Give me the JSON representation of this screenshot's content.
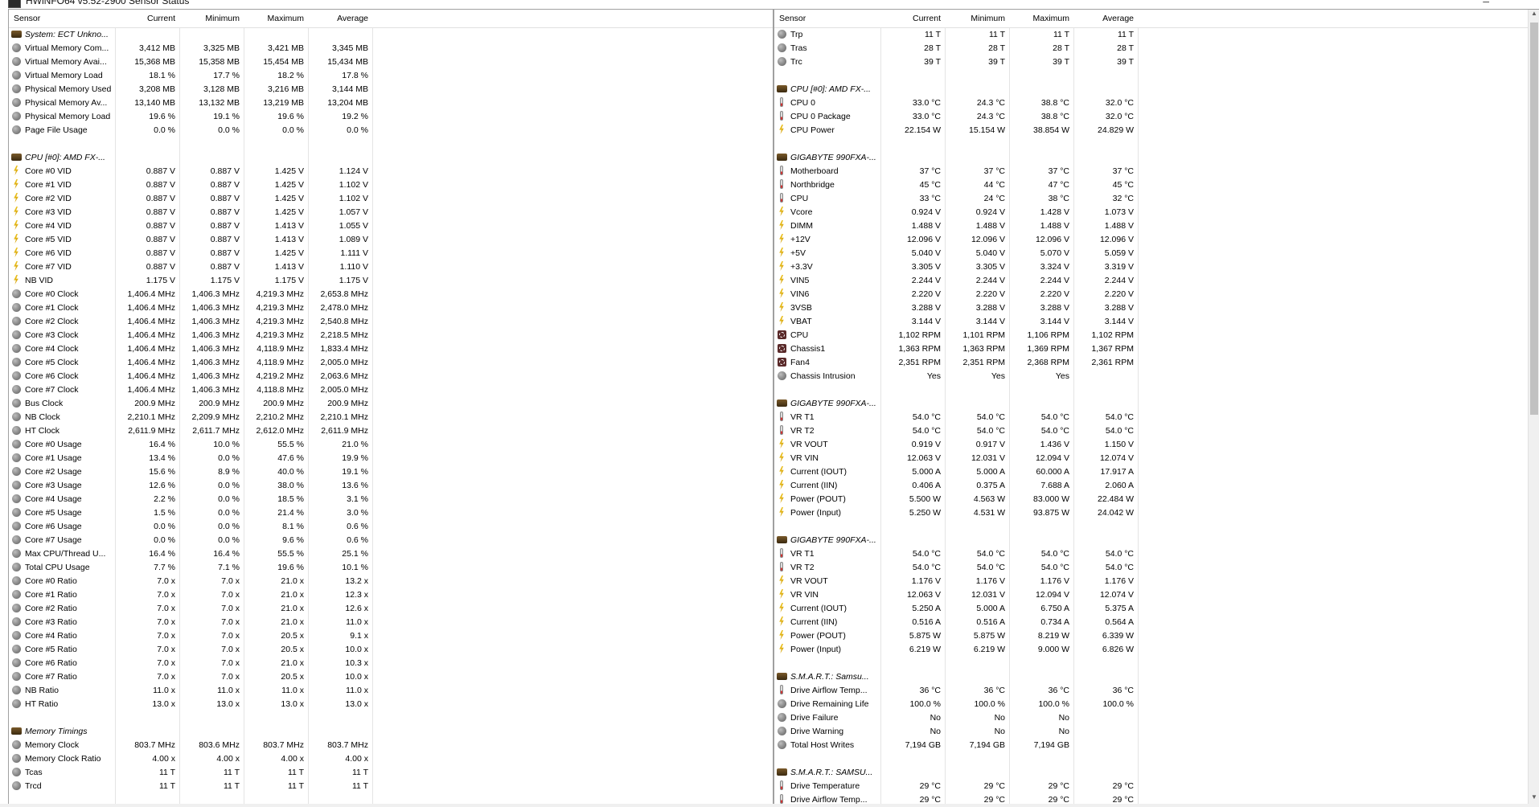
{
  "window": {
    "title": "HWiNFO64 v5.52-2900 Sensor Status"
  },
  "columns": {
    "sensor": "Sensor",
    "current": "Current",
    "minimum": "Minimum",
    "maximum": "Maximum",
    "average": "Average"
  },
  "left_rows": [
    {
      "type": "group",
      "icon": "chip",
      "label": "System: ECT Unkno..."
    },
    {
      "icon": "circle",
      "label": "Virtual Memory Com...",
      "cur": "3,412 MB",
      "min": "3,325 MB",
      "max": "3,421 MB",
      "avg": "3,345 MB"
    },
    {
      "icon": "circle",
      "label": "Virtual Memory Avai...",
      "cur": "15,368 MB",
      "min": "15,358 MB",
      "max": "15,454 MB",
      "avg": "15,434 MB"
    },
    {
      "icon": "circle",
      "label": "Virtual Memory Load",
      "cur": "18.1 %",
      "min": "17.7 %",
      "max": "18.2 %",
      "avg": "17.8 %"
    },
    {
      "icon": "circle",
      "label": "Physical Memory Used",
      "cur": "3,208 MB",
      "min": "3,128 MB",
      "max": "3,216 MB",
      "avg": "3,144 MB"
    },
    {
      "icon": "circle",
      "label": "Physical Memory Av...",
      "cur": "13,140 MB",
      "min": "13,132 MB",
      "max": "13,219 MB",
      "avg": "13,204 MB"
    },
    {
      "icon": "circle",
      "label": "Physical Memory Load",
      "cur": "19.6 %",
      "min": "19.1 %",
      "max": "19.6 %",
      "avg": "19.2 %"
    },
    {
      "icon": "circle",
      "label": "Page File Usage",
      "cur": "0.0 %",
      "min": "0.0 %",
      "max": "0.0 %",
      "avg": "0.0 %"
    },
    {
      "type": "blank"
    },
    {
      "type": "group",
      "icon": "chip",
      "label": "CPU [#0]: AMD FX-..."
    },
    {
      "icon": "bolt",
      "label": "Core #0 VID",
      "cur": "0.887 V",
      "min": "0.887 V",
      "max": "1.425 V",
      "avg": "1.124 V"
    },
    {
      "icon": "bolt",
      "label": "Core #1 VID",
      "cur": "0.887 V",
      "min": "0.887 V",
      "max": "1.425 V",
      "avg": "1.102 V"
    },
    {
      "icon": "bolt",
      "label": "Core #2 VID",
      "cur": "0.887 V",
      "min": "0.887 V",
      "max": "1.425 V",
      "avg": "1.102 V"
    },
    {
      "icon": "bolt",
      "label": "Core #3 VID",
      "cur": "0.887 V",
      "min": "0.887 V",
      "max": "1.425 V",
      "avg": "1.057 V"
    },
    {
      "icon": "bolt",
      "label": "Core #4 VID",
      "cur": "0.887 V",
      "min": "0.887 V",
      "max": "1.413 V",
      "avg": "1.055 V"
    },
    {
      "icon": "bolt",
      "label": "Core #5 VID",
      "cur": "0.887 V",
      "min": "0.887 V",
      "max": "1.413 V",
      "avg": "1.089 V"
    },
    {
      "icon": "bolt",
      "label": "Core #6 VID",
      "cur": "0.887 V",
      "min": "0.887 V",
      "max": "1.425 V",
      "avg": "1.111 V"
    },
    {
      "icon": "bolt",
      "label": "Core #7 VID",
      "cur": "0.887 V",
      "min": "0.887 V",
      "max": "1.413 V",
      "avg": "1.110 V"
    },
    {
      "icon": "bolt",
      "label": "NB VID",
      "cur": "1.175 V",
      "min": "1.175 V",
      "max": "1.175 V",
      "avg": "1.175 V"
    },
    {
      "icon": "circle",
      "label": "Core #0 Clock",
      "cur": "1,406.4 MHz",
      "min": "1,406.3 MHz",
      "max": "4,219.3 MHz",
      "avg": "2,653.8 MHz"
    },
    {
      "icon": "circle",
      "label": "Core #1 Clock",
      "cur": "1,406.4 MHz",
      "min": "1,406.3 MHz",
      "max": "4,219.3 MHz",
      "avg": "2,478.0 MHz"
    },
    {
      "icon": "circle",
      "label": "Core #2 Clock",
      "cur": "1,406.4 MHz",
      "min": "1,406.3 MHz",
      "max": "4,219.3 MHz",
      "avg": "2,540.8 MHz"
    },
    {
      "icon": "circle",
      "label": "Core #3 Clock",
      "cur": "1,406.4 MHz",
      "min": "1,406.3 MHz",
      "max": "4,219.3 MHz",
      "avg": "2,218.5 MHz"
    },
    {
      "icon": "circle",
      "label": "Core #4 Clock",
      "cur": "1,406.4 MHz",
      "min": "1,406.3 MHz",
      "max": "4,118.9 MHz",
      "avg": "1,833.4 MHz"
    },
    {
      "icon": "circle",
      "label": "Core #5 Clock",
      "cur": "1,406.4 MHz",
      "min": "1,406.3 MHz",
      "max": "4,118.9 MHz",
      "avg": "2,005.0 MHz"
    },
    {
      "icon": "circle",
      "label": "Core #6 Clock",
      "cur": "1,406.4 MHz",
      "min": "1,406.3 MHz",
      "max": "4,219.2 MHz",
      "avg": "2,063.6 MHz"
    },
    {
      "icon": "circle",
      "label": "Core #7 Clock",
      "cur": "1,406.4 MHz",
      "min": "1,406.3 MHz",
      "max": "4,118.8 MHz",
      "avg": "2,005.0 MHz"
    },
    {
      "icon": "circle",
      "label": "Bus Clock",
      "cur": "200.9 MHz",
      "min": "200.9 MHz",
      "max": "200.9 MHz",
      "avg": "200.9 MHz"
    },
    {
      "icon": "circle",
      "label": "NB Clock",
      "cur": "2,210.1 MHz",
      "min": "2,209.9 MHz",
      "max": "2,210.2 MHz",
      "avg": "2,210.1 MHz"
    },
    {
      "icon": "circle",
      "label": "HT Clock",
      "cur": "2,611.9 MHz",
      "min": "2,611.7 MHz",
      "max": "2,612.0 MHz",
      "avg": "2,611.9 MHz"
    },
    {
      "icon": "circle",
      "label": "Core #0 Usage",
      "cur": "16.4 %",
      "min": "10.0 %",
      "max": "55.5 %",
      "avg": "21.0 %"
    },
    {
      "icon": "circle",
      "label": "Core #1 Usage",
      "cur": "13.4 %",
      "min": "0.0 %",
      "max": "47.6 %",
      "avg": "19.9 %"
    },
    {
      "icon": "circle",
      "label": "Core #2 Usage",
      "cur": "15.6 %",
      "min": "8.9 %",
      "max": "40.0 %",
      "avg": "19.1 %"
    },
    {
      "icon": "circle",
      "label": "Core #3 Usage",
      "cur": "12.6 %",
      "min": "0.0 %",
      "max": "38.0 %",
      "avg": "13.6 %"
    },
    {
      "icon": "circle",
      "label": "Core #4 Usage",
      "cur": "2.2 %",
      "min": "0.0 %",
      "max": "18.5 %",
      "avg": "3.1 %"
    },
    {
      "icon": "circle",
      "label": "Core #5 Usage",
      "cur": "1.5 %",
      "min": "0.0 %",
      "max": "21.4 %",
      "avg": "3.0 %"
    },
    {
      "icon": "circle",
      "label": "Core #6 Usage",
      "cur": "0.0 %",
      "min": "0.0 %",
      "max": "8.1 %",
      "avg": "0.6 %"
    },
    {
      "icon": "circle",
      "label": "Core #7 Usage",
      "cur": "0.0 %",
      "min": "0.0 %",
      "max": "9.6 %",
      "avg": "0.6 %"
    },
    {
      "icon": "circle",
      "label": "Max CPU/Thread U...",
      "cur": "16.4 %",
      "min": "16.4 %",
      "max": "55.5 %",
      "avg": "25.1 %"
    },
    {
      "icon": "circle",
      "label": "Total CPU Usage",
      "cur": "7.7 %",
      "min": "7.1 %",
      "max": "19.6 %",
      "avg": "10.1 %"
    },
    {
      "icon": "circle",
      "label": "Core #0 Ratio",
      "cur": "7.0 x",
      "min": "7.0 x",
      "max": "21.0 x",
      "avg": "13.2 x"
    },
    {
      "icon": "circle",
      "label": "Core #1 Ratio",
      "cur": "7.0 x",
      "min": "7.0 x",
      "max": "21.0 x",
      "avg": "12.3 x"
    },
    {
      "icon": "circle",
      "label": "Core #2 Ratio",
      "cur": "7.0 x",
      "min": "7.0 x",
      "max": "21.0 x",
      "avg": "12.6 x"
    },
    {
      "icon": "circle",
      "label": "Core #3 Ratio",
      "cur": "7.0 x",
      "min": "7.0 x",
      "max": "21.0 x",
      "avg": "11.0 x"
    },
    {
      "icon": "circle",
      "label": "Core #4 Ratio",
      "cur": "7.0 x",
      "min": "7.0 x",
      "max": "20.5 x",
      "avg": "9.1 x"
    },
    {
      "icon": "circle",
      "label": "Core #5 Ratio",
      "cur": "7.0 x",
      "min": "7.0 x",
      "max": "20.5 x",
      "avg": "10.0 x"
    },
    {
      "icon": "circle",
      "label": "Core #6 Ratio",
      "cur": "7.0 x",
      "min": "7.0 x",
      "max": "21.0 x",
      "avg": "10.3 x"
    },
    {
      "icon": "circle",
      "label": "Core #7 Ratio",
      "cur": "7.0 x",
      "min": "7.0 x",
      "max": "20.5 x",
      "avg": "10.0 x"
    },
    {
      "icon": "circle",
      "label": "NB Ratio",
      "cur": "11.0 x",
      "min": "11.0 x",
      "max": "11.0 x",
      "avg": "11.0 x"
    },
    {
      "icon": "circle",
      "label": "HT Ratio",
      "cur": "13.0 x",
      "min": "13.0 x",
      "max": "13.0 x",
      "avg": "13.0 x"
    },
    {
      "type": "blank"
    },
    {
      "type": "group",
      "icon": "chip",
      "label": "Memory Timings"
    },
    {
      "icon": "circle",
      "label": "Memory Clock",
      "cur": "803.7 MHz",
      "min": "803.6 MHz",
      "max": "803.7 MHz",
      "avg": "803.7 MHz"
    },
    {
      "icon": "circle",
      "label": "Memory Clock Ratio",
      "cur": "4.00 x",
      "min": "4.00 x",
      "max": "4.00 x",
      "avg": "4.00 x"
    },
    {
      "icon": "circle",
      "label": "Tcas",
      "cur": "11 T",
      "min": "11 T",
      "max": "11 T",
      "avg": "11 T"
    },
    {
      "icon": "circle",
      "label": "Trcd",
      "cur": "11 T",
      "min": "11 T",
      "max": "11 T",
      "avg": "11 T"
    }
  ],
  "right_rows": [
    {
      "icon": "circle",
      "label": "Trp",
      "cur": "11 T",
      "min": "11 T",
      "max": "11 T",
      "avg": "11 T"
    },
    {
      "icon": "circle",
      "label": "Tras",
      "cur": "28 T",
      "min": "28 T",
      "max": "28 T",
      "avg": "28 T"
    },
    {
      "icon": "circle",
      "label": "Trc",
      "cur": "39 T",
      "min": "39 T",
      "max": "39 T",
      "avg": "39 T"
    },
    {
      "type": "blank"
    },
    {
      "type": "group",
      "icon": "chip",
      "label": "CPU [#0]: AMD FX-..."
    },
    {
      "icon": "therm",
      "label": "CPU 0",
      "cur": "33.0 °C",
      "min": "24.3 °C",
      "max": "38.8 °C",
      "avg": "32.0 °C"
    },
    {
      "icon": "therm",
      "label": "CPU 0 Package",
      "cur": "33.0 °C",
      "min": "24.3 °C",
      "max": "38.8 °C",
      "avg": "32.0 °C"
    },
    {
      "icon": "bolt",
      "label": "CPU Power",
      "cur": "22.154 W",
      "min": "15.154 W",
      "max": "38.854 W",
      "avg": "24.829 W"
    },
    {
      "type": "blank"
    },
    {
      "type": "group",
      "icon": "chip",
      "label": "GIGABYTE 990FXA-..."
    },
    {
      "icon": "therm",
      "label": "Motherboard",
      "cur": "37 °C",
      "min": "37 °C",
      "max": "37 °C",
      "avg": "37 °C"
    },
    {
      "icon": "therm",
      "label": "Northbridge",
      "cur": "45 °C",
      "min": "44 °C",
      "max": "47 °C",
      "avg": "45 °C"
    },
    {
      "icon": "therm",
      "label": "CPU",
      "cur": "33 °C",
      "min": "24 °C",
      "max": "38 °C",
      "avg": "32 °C"
    },
    {
      "icon": "bolt",
      "label": "Vcore",
      "cur": "0.924 V",
      "min": "0.924 V",
      "max": "1.428 V",
      "avg": "1.073 V"
    },
    {
      "icon": "bolt",
      "label": "DIMM",
      "cur": "1.488 V",
      "min": "1.488 V",
      "max": "1.488 V",
      "avg": "1.488 V"
    },
    {
      "icon": "bolt",
      "label": "+12V",
      "cur": "12.096 V",
      "min": "12.096 V",
      "max": "12.096 V",
      "avg": "12.096 V"
    },
    {
      "icon": "bolt",
      "label": "+5V",
      "cur": "5.040 V",
      "min": "5.040 V",
      "max": "5.070 V",
      "avg": "5.059 V"
    },
    {
      "icon": "bolt",
      "label": "+3.3V",
      "cur": "3.305 V",
      "min": "3.305 V",
      "max": "3.324 V",
      "avg": "3.319 V"
    },
    {
      "icon": "bolt",
      "label": "VIN5",
      "cur": "2.244 V",
      "min": "2.244 V",
      "max": "2.244 V",
      "avg": "2.244 V"
    },
    {
      "icon": "bolt",
      "label": "VIN6",
      "cur": "2.220 V",
      "min": "2.220 V",
      "max": "2.220 V",
      "avg": "2.220 V"
    },
    {
      "icon": "bolt",
      "label": "3VSB",
      "cur": "3.288 V",
      "min": "3.288 V",
      "max": "3.288 V",
      "avg": "3.288 V"
    },
    {
      "icon": "bolt",
      "label": "VBAT",
      "cur": "3.144 V",
      "min": "3.144 V",
      "max": "3.144 V",
      "avg": "3.144 V"
    },
    {
      "icon": "fan",
      "label": "CPU",
      "cur": "1,102 RPM",
      "min": "1,101 RPM",
      "max": "1,106 RPM",
      "avg": "1,102 RPM"
    },
    {
      "icon": "fan",
      "label": "Chassis1",
      "cur": "1,363 RPM",
      "min": "1,363 RPM",
      "max": "1,369 RPM",
      "avg": "1,367 RPM"
    },
    {
      "icon": "fan",
      "label": "Fan4",
      "cur": "2,351 RPM",
      "min": "2,351 RPM",
      "max": "2,368 RPM",
      "avg": "2,361 RPM"
    },
    {
      "icon": "circle",
      "label": "Chassis Intrusion",
      "cur": "Yes",
      "min": "Yes",
      "max": "Yes",
      "avg": ""
    },
    {
      "type": "blank"
    },
    {
      "type": "group",
      "icon": "chip",
      "label": "GIGABYTE 990FXA-..."
    },
    {
      "icon": "therm",
      "label": "VR T1",
      "cur": "54.0 °C",
      "min": "54.0 °C",
      "max": "54.0 °C",
      "avg": "54.0 °C"
    },
    {
      "icon": "therm",
      "label": "VR T2",
      "cur": "54.0 °C",
      "min": "54.0 °C",
      "max": "54.0 °C",
      "avg": "54.0 °C"
    },
    {
      "icon": "bolt",
      "label": "VR VOUT",
      "cur": "0.919 V",
      "min": "0.917 V",
      "max": "1.436 V",
      "avg": "1.150 V"
    },
    {
      "icon": "bolt",
      "label": "VR VIN",
      "cur": "12.063 V",
      "min": "12.031 V",
      "max": "12.094 V",
      "avg": "12.074 V"
    },
    {
      "icon": "bolt",
      "label": "Current (IOUT)",
      "cur": "5.000 A",
      "min": "5.000 A",
      "max": "60.000 A",
      "avg": "17.917 A"
    },
    {
      "icon": "bolt",
      "label": "Current (IIN)",
      "cur": "0.406 A",
      "min": "0.375 A",
      "max": "7.688 A",
      "avg": "2.060 A"
    },
    {
      "icon": "bolt",
      "label": "Power (POUT)",
      "cur": "5.500 W",
      "min": "4.563 W",
      "max": "83.000 W",
      "avg": "22.484 W"
    },
    {
      "icon": "bolt",
      "label": "Power (Input)",
      "cur": "5.250 W",
      "min": "4.531 W",
      "max": "93.875 W",
      "avg": "24.042 W"
    },
    {
      "type": "blank"
    },
    {
      "type": "group",
      "icon": "chip",
      "label": "GIGABYTE 990FXA-..."
    },
    {
      "icon": "therm",
      "label": "VR T1",
      "cur": "54.0 °C",
      "min": "54.0 °C",
      "max": "54.0 °C",
      "avg": "54.0 °C"
    },
    {
      "icon": "therm",
      "label": "VR T2",
      "cur": "54.0 °C",
      "min": "54.0 °C",
      "max": "54.0 °C",
      "avg": "54.0 °C"
    },
    {
      "icon": "bolt",
      "label": "VR VOUT",
      "cur": "1.176 V",
      "min": "1.176 V",
      "max": "1.176 V",
      "avg": "1.176 V"
    },
    {
      "icon": "bolt",
      "label": "VR VIN",
      "cur": "12.063 V",
      "min": "12.031 V",
      "max": "12.094 V",
      "avg": "12.074 V"
    },
    {
      "icon": "bolt",
      "label": "Current (IOUT)",
      "cur": "5.250 A",
      "min": "5.000 A",
      "max": "6.750 A",
      "avg": "5.375 A"
    },
    {
      "icon": "bolt",
      "label": "Current (IIN)",
      "cur": "0.516 A",
      "min": "0.516 A",
      "max": "0.734 A",
      "avg": "0.564 A"
    },
    {
      "icon": "bolt",
      "label": "Power (POUT)",
      "cur": "5.875 W",
      "min": "5.875 W",
      "max": "8.219 W",
      "avg": "6.339 W"
    },
    {
      "icon": "bolt",
      "label": "Power (Input)",
      "cur": "6.219 W",
      "min": "6.219 W",
      "max": "9.000 W",
      "avg": "6.826 W"
    },
    {
      "type": "blank"
    },
    {
      "type": "group",
      "icon": "chip",
      "label": "S.M.A.R.T.: Samsu..."
    },
    {
      "icon": "therm",
      "label": "Drive Airflow Temp...",
      "cur": "36 °C",
      "min": "36 °C",
      "max": "36 °C",
      "avg": "36 °C"
    },
    {
      "icon": "circle",
      "label": "Drive Remaining Life",
      "cur": "100.0 %",
      "min": "100.0 %",
      "max": "100.0 %",
      "avg": "100.0 %"
    },
    {
      "icon": "circle",
      "label": "Drive Failure",
      "cur": "No",
      "min": "No",
      "max": "No",
      "avg": ""
    },
    {
      "icon": "circle",
      "label": "Drive Warning",
      "cur": "No",
      "min": "No",
      "max": "No",
      "avg": ""
    },
    {
      "icon": "circle",
      "label": "Total Host Writes",
      "cur": "7,194 GB",
      "min": "7,194 GB",
      "max": "7,194 GB",
      "avg": ""
    },
    {
      "type": "blank"
    },
    {
      "type": "group",
      "icon": "chip",
      "label": "S.M.A.R.T.: SAMSU..."
    },
    {
      "icon": "therm",
      "label": "Drive Temperature",
      "cur": "29 °C",
      "min": "29 °C",
      "max": "29 °C",
      "avg": "29 °C"
    },
    {
      "icon": "therm",
      "label": "Drive Airflow Temp...",
      "cur": "29 °C",
      "min": "29 °C",
      "max": "29 °C",
      "avg": "29 °C"
    }
  ]
}
